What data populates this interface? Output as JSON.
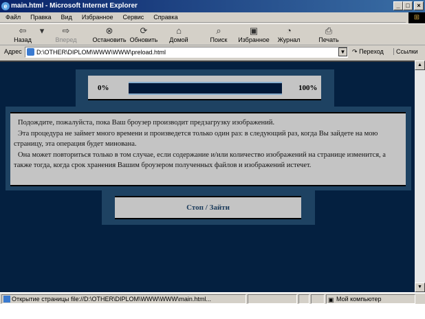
{
  "window": {
    "title": "main.html - Microsoft Internet Explorer"
  },
  "menu": [
    "Файл",
    "Правка",
    "Вид",
    "Избранное",
    "Сервис",
    "Справка"
  ],
  "toolbar": [
    {
      "label": "Назад",
      "icon": "back-arrow-icon",
      "glyph": "⇦"
    },
    {
      "label": "Вперед",
      "icon": "forward-arrow-icon",
      "glyph": "⇨"
    },
    {
      "label": "Остановить",
      "icon": "stop-icon",
      "glyph": "⊗"
    },
    {
      "label": "Обновить",
      "icon": "refresh-icon",
      "glyph": "⟳"
    },
    {
      "label": "Домой",
      "icon": "home-icon",
      "glyph": "⌂"
    },
    {
      "label": "Поиск",
      "icon": "search-icon",
      "glyph": "⌕"
    },
    {
      "label": "Избранное",
      "icon": "favorites-icon",
      "glyph": "▣"
    },
    {
      "label": "Журнал",
      "icon": "history-icon",
      "glyph": "◔"
    },
    {
      "label": "Печать",
      "icon": "print-icon",
      "glyph": "⎙"
    }
  ],
  "address": {
    "label": "Адрес",
    "value": "D:\\OTHER\\DIPLOM\\WWW\\WWW\\preload.html",
    "go": "Переход",
    "links": "Ссылки"
  },
  "page": {
    "progress": {
      "min_label": "0%",
      "max_label": "100%",
      "value_percent": 100
    },
    "paragraphs": [
      "Подождите, пожалуйста, пока Ваш броузер производит предзагрузку изображений.",
      "Эта процедура не займет много времени и произведется только один раз: в следующий раз, когда Вы зайдете на мою страницу, эта операция будет минована.",
      "Она может повториться только в том случае, если содержание и/или количество изображений на странице изменится, а также тогда, когда срок хранения Вашим броузером полученных файлов и изображений истечет."
    ],
    "button": "Стоп / Зайти"
  },
  "status": {
    "text": "Открытие страницы file://D:\\OTHER\\DIPLOM\\WWW\\WWW\\main.html...",
    "zone": "Мой компьютер"
  },
  "colors": {
    "page_bg": "#042040",
    "panel": "#1e4262",
    "bar": "#001838"
  }
}
